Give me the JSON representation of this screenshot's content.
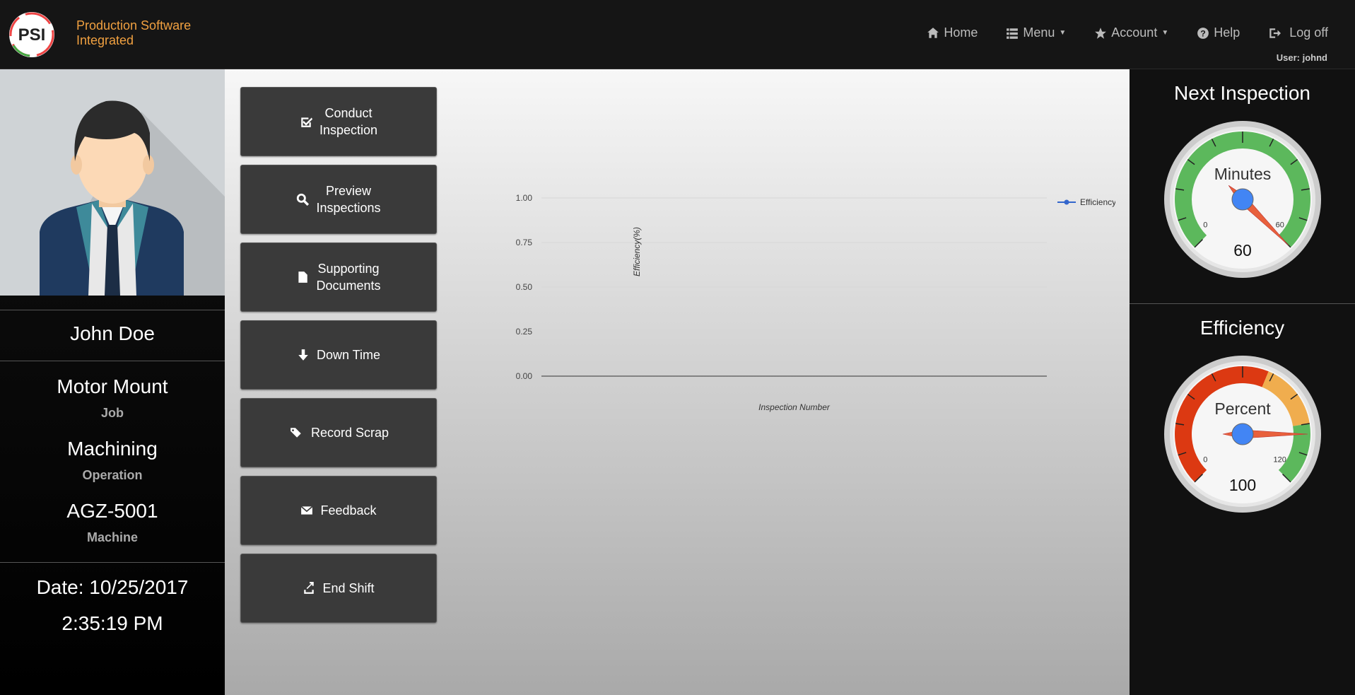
{
  "nav": {
    "brand_line1": "Production Software",
    "brand_line2": "Integrated",
    "logo_text": "PSI",
    "home": "Home",
    "menu": "Menu",
    "account": "Account",
    "help": "Help",
    "logoff": "Log off",
    "user": "User: johnd"
  },
  "profile": {
    "name": "John Doe",
    "job": "Motor Mount",
    "job_label": "Job",
    "operation": "Machining",
    "operation_label": "Operation",
    "machine": "AGZ-5001",
    "machine_label": "Machine",
    "date": "Date: 10/25/2017",
    "time": "2:35:19 PM"
  },
  "actions": [
    {
      "label_line1": "Conduct",
      "label_line2": "Inspection",
      "icon": "check-square-icon"
    },
    {
      "label_line1": "Preview",
      "label_line2": "Inspections",
      "icon": "search-icon"
    },
    {
      "label_line1": "Supporting",
      "label_line2": "Documents",
      "icon": "document-icon"
    },
    {
      "label_line1": "Down Time",
      "label_line2": "",
      "icon": "arrow-down-icon"
    },
    {
      "label_line1": "Record Scrap",
      "label_line2": "",
      "icon": "tags-icon"
    },
    {
      "label_line1": "Feedback",
      "label_line2": "",
      "icon": "envelope-icon"
    },
    {
      "label_line1": "End Shift",
      "label_line2": "",
      "icon": "export-icon"
    }
  ],
  "chart_data": {
    "type": "line",
    "series": [
      {
        "name": "Efficiency",
        "values": []
      }
    ],
    "x": [],
    "xlabel": "Inspection Number",
    "ylabel": "Efficiency(%)",
    "ylim": [
      0,
      1
    ],
    "yticks": [
      "1.00",
      "0.75",
      "0.50",
      "0.25",
      "0.00"
    ],
    "grid": true,
    "legend": "top-right",
    "colors": {
      "series": "#3366cc"
    }
  },
  "gauges": {
    "inspection": {
      "title": "Next Inspection",
      "unit": "Minutes",
      "value": 60,
      "min": 0,
      "max": 60,
      "min_label": "0",
      "max_label": "60",
      "value_label": "60"
    },
    "efficiency": {
      "title": "Efficiency",
      "unit": "Percent",
      "value": 100,
      "min": 0,
      "max": 120,
      "min_label": "0",
      "max_label": "120",
      "value_label": "100"
    }
  },
  "colors": {
    "accent": "#f0a040",
    "green": "#5cb85c",
    "red": "#dc3912",
    "orange": "#f0ad4e",
    "needle": "#e8603c",
    "hub": "#4285f4"
  }
}
